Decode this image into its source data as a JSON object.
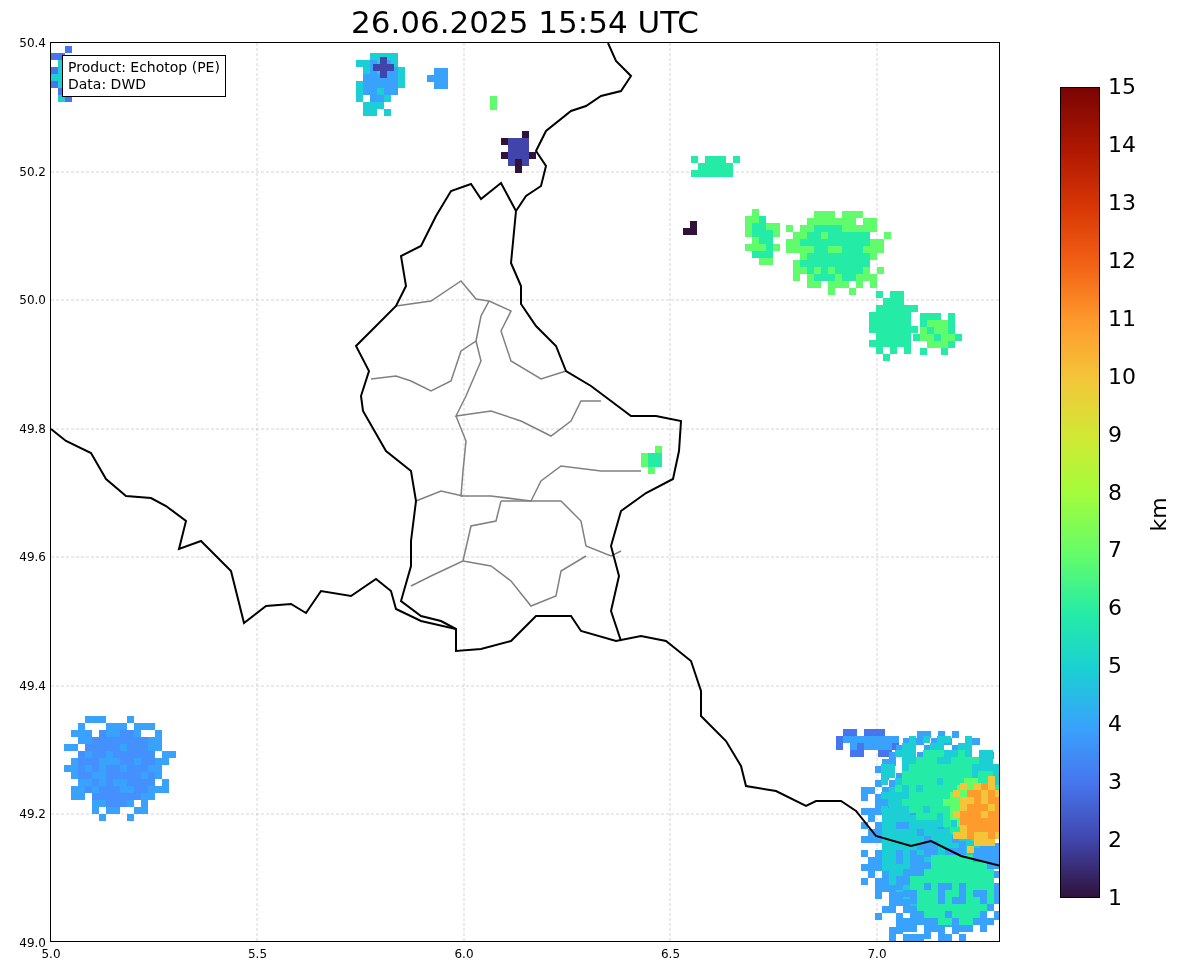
{
  "title": "26.06.2025 15:54 UTC",
  "legend": [
    "Product: Echotop (PE)",
    "Data: DWD"
  ],
  "x_ticks": [
    "5.0",
    "5.5",
    "6.0",
    "6.5",
    "7.0"
  ],
  "y_ticks": [
    "50.4",
    "50.2",
    "50.0",
    "49.8",
    "49.6",
    "49.4",
    "49.2",
    "49.0"
  ],
  "colorbar": {
    "label": "km",
    "ticks": [
      "15",
      "14",
      "13",
      "12",
      "11",
      "10",
      "9",
      "8",
      "7",
      "6",
      "5",
      "4",
      "3",
      "2",
      "1"
    ]
  }
}
